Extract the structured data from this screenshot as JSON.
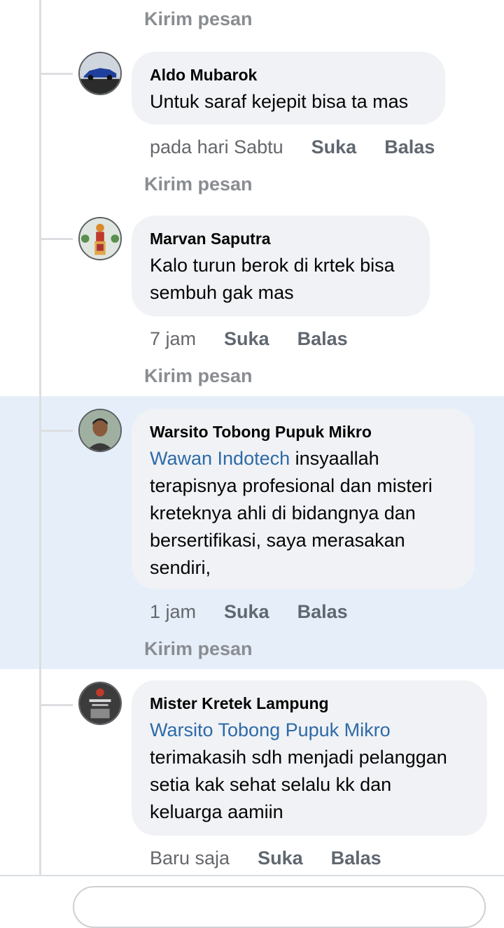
{
  "send_message_label": "Kirim pesan",
  "like_label": "Suka",
  "reply_label": "Balas",
  "comments": [
    {
      "author": "Aldo Mubarok",
      "text": "Untuk saraf kejepit bisa ta mas",
      "time": "pada hari Sabtu"
    },
    {
      "author": "Marvan Saputra",
      "text_line1": "Kalo turun berok di krtek bisa",
      "text_line2": "sembuh gak mas",
      "time": "7 jam"
    },
    {
      "author": "Warsito Tobong Pupuk Mikro",
      "mention": "Wawan Indotech",
      "text_line1": " insyaallah",
      "text_line2": "terapisnya profesional dan misteri",
      "text_line3": "kreteknya ahli di bidangnya dan",
      "text_line4": "bersertifikasi, saya merasakan",
      "text_line5": "sendiri,",
      "time": "1 jam",
      "highlighted": true
    },
    {
      "author": "Mister Kretek Lampung",
      "mention": "Warsito Tobong Pupuk Mikro",
      "text_line1": "terimakasih sdh menjadi pelanggan",
      "text_line2": "setia kak sehat selalu kk dan",
      "text_line3": "keluarga aamiin",
      "time": "Baru saja"
    }
  ],
  "colors": {
    "mention": "#2d6aa8",
    "highlight_bg": "#e6eff9",
    "bubble_bg": "#f0f2f5",
    "muted_text": "#606770"
  }
}
